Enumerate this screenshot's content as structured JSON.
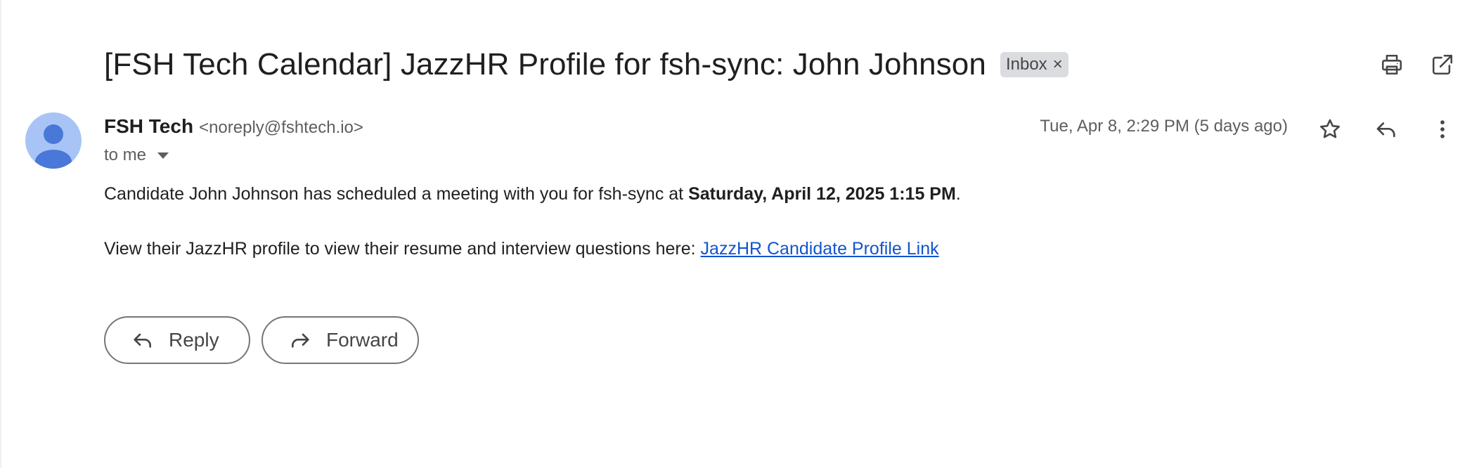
{
  "email": {
    "subject": "[FSH Tech Calendar] JazzHR Profile for fsh-sync: John Johnson",
    "label": "Inbox",
    "label_close": "×",
    "sender_name": "FSH Tech",
    "sender_email": "<noreply@fshtech.io>",
    "recipient_text": "to me",
    "date": "Tue, Apr 8, 2:29 PM (5 days ago)",
    "body": {
      "p1_prefix": "Candidate John Johnson has scheduled a meeting with you for fsh-sync at ",
      "p1_bold": "Saturday, April 12, 2025 1:15 PM",
      "p1_suffix": ".",
      "p2_prefix": "View their JazzHR profile to view their resume and interview questions here: ",
      "p2_link": "JazzHR Candidate Profile Link"
    }
  },
  "actions": {
    "reply_label": "Reply",
    "forward_label": "Forward"
  },
  "icons": {
    "print": "print-icon",
    "popout": "open-in-new-window-icon",
    "star": "star-icon",
    "reply": "reply-icon",
    "more": "more-vertical-icon",
    "forward": "forward-icon",
    "avatar": "default-avatar-icon",
    "caret": "caret-down-icon"
  },
  "colors": {
    "avatar_bg": "#a8c4f7",
    "avatar_fg": "#4a78d8",
    "link": "#1155cc",
    "chip_bg": "#dadce0"
  }
}
